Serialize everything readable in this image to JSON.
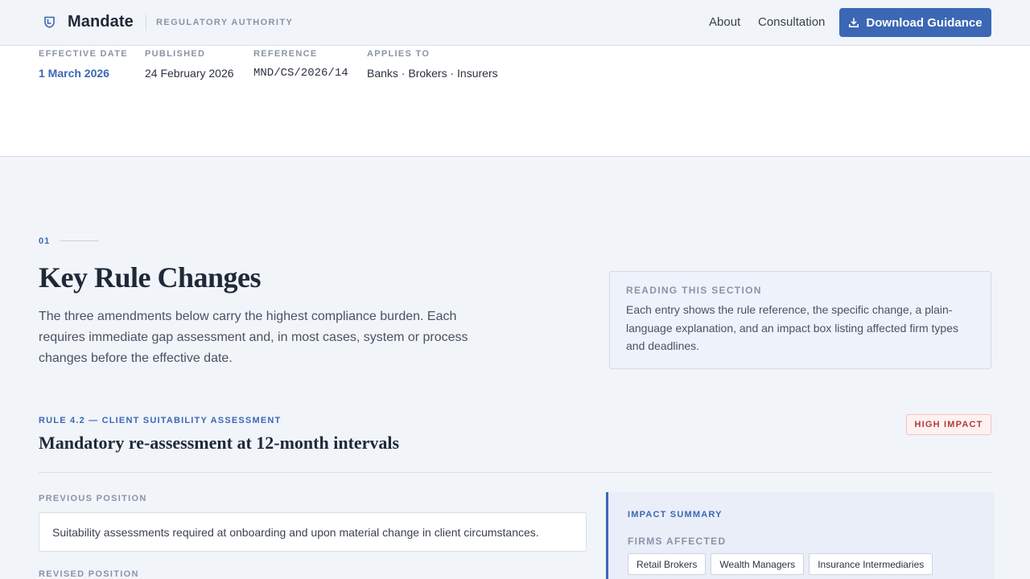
{
  "header": {
    "brand": "Mandate",
    "brand_sub": "REGULATORY AUTHORITY",
    "nav": [
      "About",
      "Consultation"
    ],
    "download_label": "Download Guidance",
    "accent_color": "#3b67b5"
  },
  "meta": [
    {
      "label": "EFFECTIVE DATE",
      "value": "1 March 2026"
    },
    {
      "label": "PUBLISHED",
      "value": "24 February 2026"
    },
    {
      "label": "REFERENCE",
      "value": "MND/CS/2026/14"
    },
    {
      "label": "APPLIES TO",
      "value": "Banks · Brokers · Insurers"
    }
  ],
  "section": {
    "number": "01",
    "title": "Key Rule Changes",
    "intro": "The three amendments below carry the highest compliance burden. Each requires immediate gap assessment and, in most cases, system or process changes before the effective date.",
    "reading_title": "READING THIS SECTION",
    "reading_text": "Each entry shows the rule reference, the specific change, a plain-language explanation, and an impact box listing affected firm types and deadlines."
  },
  "rule": {
    "ref": "RULE 4.2 — CLIENT SUITABILITY ASSESSMENT",
    "title": "Mandatory re-assessment at 12-month intervals",
    "badge": "HIGH IMPACT",
    "badge_color": "#b53a3a",
    "previous_label": "PREVIOUS POSITION",
    "previous_text": "Suitability assessments required at onboarding and upon material change in client circumstances.",
    "revised_label": "REVISED POSITION",
    "impact_title": "IMPACT SUMMARY",
    "firms_label": "FIRMS AFFECTED",
    "firms": [
      "Retail Brokers",
      "Wealth Managers",
      "Insurance Intermediaries"
    ]
  },
  "icons": {
    "logo": "shield-icon",
    "download": "download-icon"
  }
}
